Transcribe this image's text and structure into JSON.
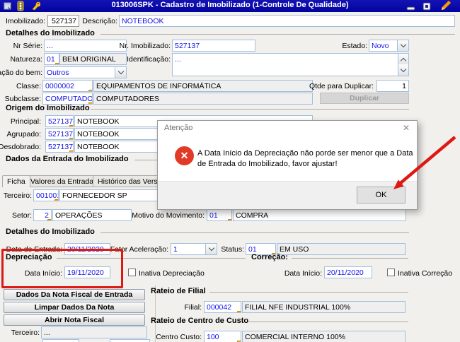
{
  "window": {
    "title": "013006SPK - Cadastro de Imobilizado (1-Controle De Qualidade)"
  },
  "topbar": {
    "imobilizado_label": "Imobilizado:",
    "imobilizado_value": "527137",
    "descricao_label": "Descrição:",
    "descricao_value": "NOTEBOOK"
  },
  "section_titles": {
    "detalhes": "Detalhes do Imobilizado",
    "origem": "Origem do Imobilizado",
    "dados_entrada": "Dados da Entrada do Imobilizado",
    "detalhes2": "Detalhes do Imobilizado",
    "depreciacao": "Depreciação",
    "correcao": "Correção:",
    "rateio_filial": "Rateio de Filial",
    "rateio_cc": "Rateio de Centro de Custo"
  },
  "detalhes": {
    "nr_serie": {
      "label": "Nr Série:",
      "value": "..."
    },
    "nr_imobilizado": {
      "label": "Nr. Imobilizado:",
      "value": "527137"
    },
    "estado": {
      "label": "Estado:",
      "value": "Novo"
    },
    "natureza": {
      "label": "Natureza:",
      "code": "01",
      "desc": "BEM ORIGINAL"
    },
    "identificacao": {
      "label": "Identificação:",
      "value": "..."
    },
    "utilizacao": {
      "label": "Utilização do bem:",
      "value": "Outros"
    },
    "classe": {
      "label": "Classe:",
      "code": "0000002",
      "desc": "EQUIPAMENTOS DE INFORMÁTICA"
    },
    "subclasse": {
      "label": "Subclasse:",
      "code": "COMPUTADORES",
      "desc": "COMPUTADORES"
    },
    "qtde_duplicar": {
      "label": "Qtde para Duplicar:",
      "value": "1"
    },
    "duplicar_button": "Duplicar"
  },
  "origem": {
    "principal": {
      "label": "Principal:",
      "code": "527137",
      "desc": "NOTEBOOK"
    },
    "agrupado": {
      "label": "Agrupado:",
      "code": "527137",
      "desc": "NOTEBOOK"
    },
    "desdobrado": {
      "label": "Desdobrado:",
      "code": "527137",
      "desc": "NOTEBOOK"
    }
  },
  "tabs": [
    {
      "label": "Ficha"
    },
    {
      "label": "Valores da Entrada"
    },
    {
      "label": "Histórico das Versões"
    }
  ],
  "ficha": {
    "terceiro": {
      "label": "Terceiro:",
      "code": "001001",
      "desc": "FORNECEDOR SP"
    },
    "setor": {
      "label": "Setor:",
      "code": "2",
      "desc": "OPERAÇÕES"
    },
    "motivo": {
      "label": "Motivo do Movimento:",
      "code": "01",
      "desc": "COMPRA"
    }
  },
  "detalhes2": {
    "data_entrada": {
      "label": "Data de Entrada:",
      "value": "20/11/2020"
    },
    "fator": {
      "label": "Fator Aceleração:",
      "value": "1"
    },
    "status": {
      "label": "Status:",
      "code": "01",
      "desc": "EM USO"
    },
    "dep_data_inicio": {
      "label": "Data Início:",
      "value": "19/11/2020"
    },
    "inativa_dep_label": "Inativa Depreciação",
    "cor_data_inicio": {
      "label": "Data Início:",
      "value": "20/11/2020"
    },
    "inativa_cor_label": "Inativa Correção"
  },
  "nota_fiscal": {
    "btn_dados": "Dados Da Nota Fiscal de Entrada",
    "btn_limpar": "Limpar Dados Da Nota",
    "btn_abrir": "Abrir Nota Fiscal",
    "terceiro": {
      "label": "Terceiro:",
      "value": "..."
    }
  },
  "rateio": {
    "filial": {
      "label": "Filial:",
      "code": "000042",
      "desc": "FILIAL NFE INDUSTRIAL 100%"
    },
    "centro_custo": {
      "label": "Centro Custo:",
      "code": "100",
      "desc": "COMERCIAL INTERNO 100%"
    }
  },
  "dialog": {
    "title": "Atenção",
    "close": "✕",
    "icon_glyph": "✕",
    "message": "A Data Início da Depreciação não porde ser menor que a Data de Entrada do Imobilizado, favor ajustar!",
    "ok": "OK"
  },
  "colors": {
    "titlebar": "#0202A0",
    "field_text": "#1414E6",
    "annotation_red": "#DE1812",
    "error_icon_red": "#E13B28"
  }
}
